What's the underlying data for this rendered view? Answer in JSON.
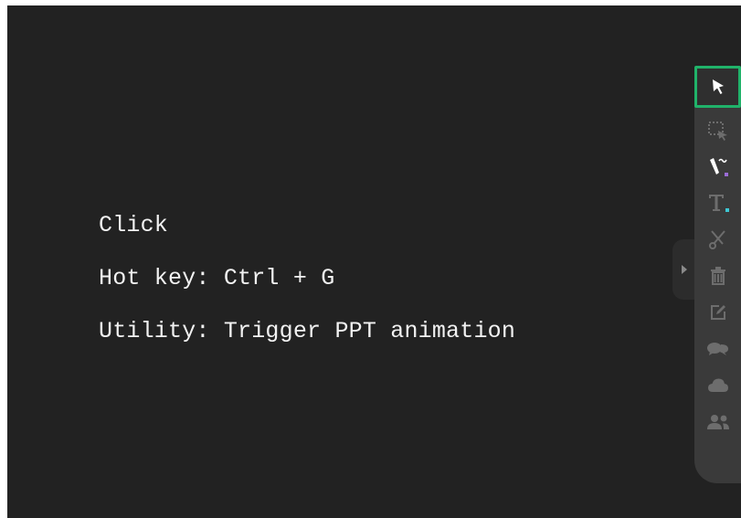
{
  "info_lines": {
    "line1": "Click",
    "line2": "Hot key: Ctrl + G",
    "line3": "Utility: Trigger PPT animation"
  },
  "toolbar": {
    "tools": [
      {
        "icon": "select-cursor-icon",
        "active": true
      },
      {
        "icon": "area-select-icon",
        "active": false
      },
      {
        "icon": "pen-icon",
        "active": false,
        "indicator_color": "#9b6cd6"
      },
      {
        "icon": "text-icon",
        "active": false,
        "indicator_color": "#3ec7d3"
      },
      {
        "icon": "scissors-icon",
        "active": false
      },
      {
        "icon": "trash-icon",
        "active": false
      },
      {
        "icon": "edit-icon",
        "active": false
      },
      {
        "icon": "comments-icon",
        "active": false
      },
      {
        "icon": "cloud-icon",
        "active": false
      },
      {
        "icon": "users-icon",
        "active": false
      }
    ]
  },
  "colors": {
    "canvas_bg": "#222222",
    "toolbar_bg": "#3a3a3a",
    "active_border": "#20b36a",
    "text": "#f2f2f2",
    "icon_dim": "#6d6d6d"
  }
}
